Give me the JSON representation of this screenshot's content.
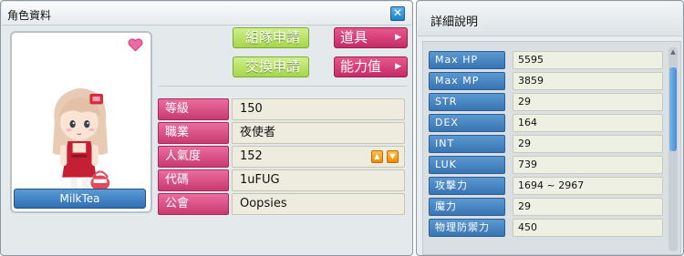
{
  "character_window": {
    "title": "角色資料",
    "close_icon": "close-x-icon",
    "character_name": "MilkTea",
    "buttons": {
      "party_request": "組隊申請",
      "trade_request": "交換申請",
      "items": "道具",
      "stats": "能力值"
    },
    "info": [
      {
        "label": "等級",
        "value": "150"
      },
      {
        "label": "職業",
        "value": "夜使者"
      },
      {
        "label": "人氣度",
        "value": "152"
      },
      {
        "label": "代碼",
        "value": "1uFUG"
      },
      {
        "label": "公會",
        "value": "Oopsies"
      }
    ],
    "fame_up_icon": "arrow-up-icon",
    "fame_down_icon": "arrow-down-icon",
    "heart_icon": "heart-icon"
  },
  "detail_window": {
    "title": "詳細說明",
    "stats": [
      {
        "label": "Max HP",
        "value": "5595"
      },
      {
        "label": "Max MP",
        "value": "3859"
      },
      {
        "label": "STR",
        "value": "29"
      },
      {
        "label": "DEX",
        "value": "164"
      },
      {
        "label": "INT",
        "value": "29"
      },
      {
        "label": "LUK",
        "value": "739"
      },
      {
        "label": "攻擊力",
        "value": "1694 ~ 2967"
      },
      {
        "label": "魔力",
        "value": "29"
      },
      {
        "label": "物理防禦力",
        "value": "450"
      }
    ]
  },
  "colors": {
    "pink_label": "#d44a7d",
    "blue_label": "#4a86c4",
    "green_button": "#b5e05f",
    "red_button": "#d23b71"
  }
}
